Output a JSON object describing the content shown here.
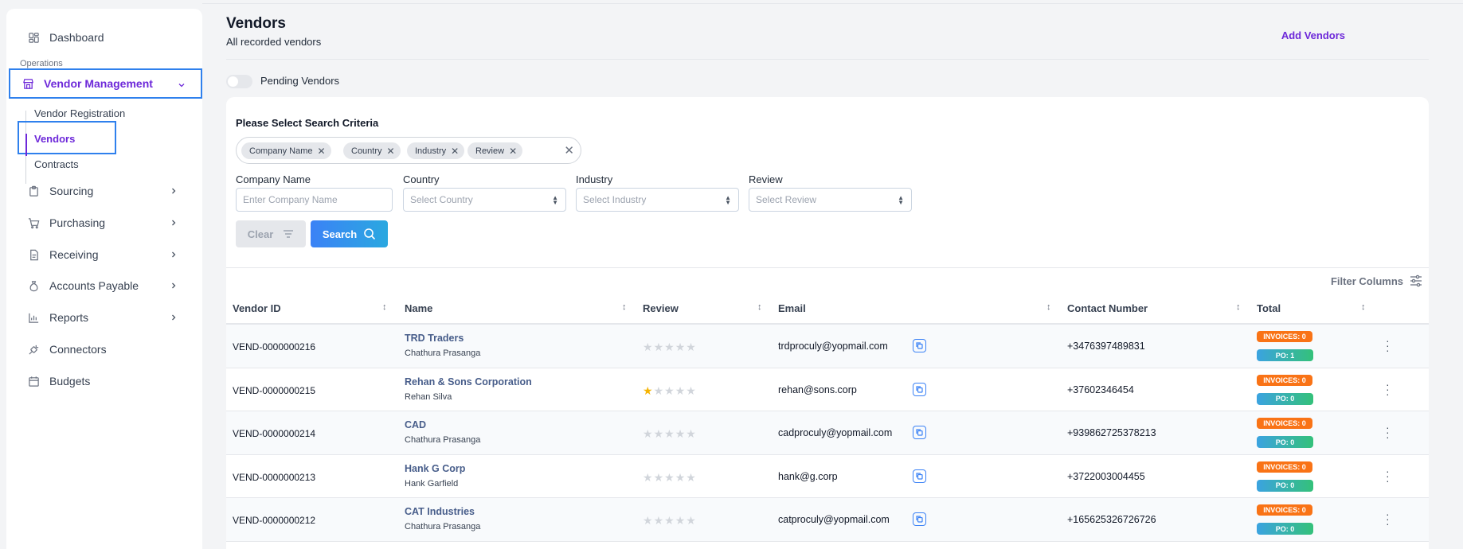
{
  "sidebar": {
    "dashboard": "Dashboard",
    "section": "Operations",
    "vendor_management": "Vendor Management",
    "sub_items": [
      "Vendor Registration",
      "Vendors",
      "Contracts"
    ],
    "items": [
      "Sourcing",
      "Purchasing",
      "Receiving",
      "Accounts Payable",
      "Reports"
    ],
    "connectors": "Connectors",
    "budgets": "Budgets"
  },
  "header": {
    "title": "Vendors",
    "subtitle": "All recorded vendors",
    "add_label": "Add Vendors"
  },
  "pending_toggle": {
    "label": "Pending Vendors",
    "on": false
  },
  "search": {
    "title": "Please Select Search Criteria",
    "chips": [
      "Company Name",
      "Country",
      "Industry",
      "Review"
    ],
    "fields": {
      "company_label": "Company Name",
      "company_placeholder": "Enter Company Name",
      "country_label": "Country",
      "country_placeholder": "Select Country",
      "industry_label": "Industry",
      "industry_placeholder": "Select Industry",
      "review_label": "Review",
      "review_placeholder": "Select Review"
    },
    "clear_label": "Clear",
    "search_label": "Search"
  },
  "table": {
    "filter_columns_label": "Filter Columns",
    "columns": [
      "Vendor ID",
      "Name",
      "Review",
      "Email",
      "Contact Number",
      "Total"
    ],
    "rows": [
      {
        "id": "VEND-0000000216",
        "name": "TRD Traders",
        "contact": "Chathura Prasanga",
        "rating": 0,
        "email": "trdproculy@yopmail.com",
        "phone": "+3476397489831",
        "invoices": "INVOICES: 0",
        "po": "PO: 1"
      },
      {
        "id": "VEND-0000000215",
        "name": "Rehan & Sons Corporation",
        "contact": "Rehan Silva",
        "rating": 1,
        "email": "rehan@sons.corp",
        "phone": "+37602346454",
        "invoices": "INVOICES: 0",
        "po": "PO: 0"
      },
      {
        "id": "VEND-0000000214",
        "name": "CAD",
        "contact": "Chathura Prasanga",
        "rating": 0,
        "email": "cadproculy@yopmail.com",
        "phone": "+939862725378213",
        "invoices": "INVOICES: 0",
        "po": "PO: 0"
      },
      {
        "id": "VEND-0000000213",
        "name": "Hank G Corp",
        "contact": "Hank Garfield",
        "rating": 0,
        "email": "hank@g.corp",
        "phone": "+3722003004455",
        "invoices": "INVOICES: 0",
        "po": "PO: 0"
      },
      {
        "id": "VEND-0000000212",
        "name": "CAT Industries",
        "contact": "Chathura Prasanga",
        "rating": 0,
        "email": "catproculy@yopmail.com",
        "phone": "+165625326726726",
        "invoices": "INVOICES: 0",
        "po": "PO: 0"
      }
    ]
  },
  "colors": {
    "accent": "#6d28d9",
    "primary": "#3b82f6",
    "invoice_badge": "#f97316",
    "po_badge": "#34c17a",
    "star": "#f5b301"
  }
}
